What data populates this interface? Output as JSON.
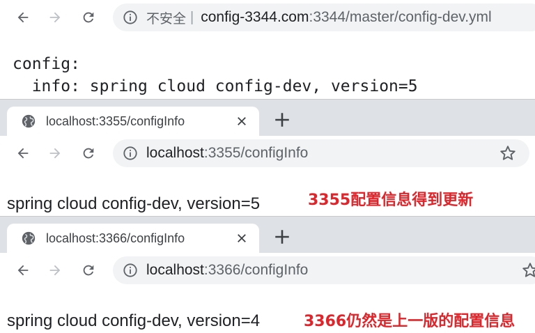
{
  "top_window": {
    "security_label": "不安全",
    "separator": "|",
    "url_host": "config-3344.com",
    "url_rest": ":3344/master/config-dev.yml",
    "yaml_lines": [
      "config:",
      "  info: spring cloud config-dev, version=5"
    ]
  },
  "client_3355": {
    "tab_title": "localhost:3355/configInfo",
    "url_host": "localhost",
    "url_rest": ":3355/configInfo",
    "response": "spring cloud config-dev, version=5",
    "annotation": "3355配置信息得到更新"
  },
  "client_3366": {
    "tab_title": "localhost:3366/configInfo",
    "url_host": "localhost",
    "url_rest": ":3366/configInfo",
    "response": "spring cloud config-dev, version=4",
    "annotation": "3366仍然是上一版的配置信息"
  },
  "colors": {
    "annotation": "#e0242a",
    "omnibox_bg": "#f1f3f4",
    "tabstrip_bg": "#dee1e6"
  },
  "icons": [
    "back-arrow-icon",
    "forward-arrow-icon",
    "reload-icon",
    "info-icon",
    "globe-icon",
    "close-icon",
    "plus-icon",
    "star-icon"
  ]
}
